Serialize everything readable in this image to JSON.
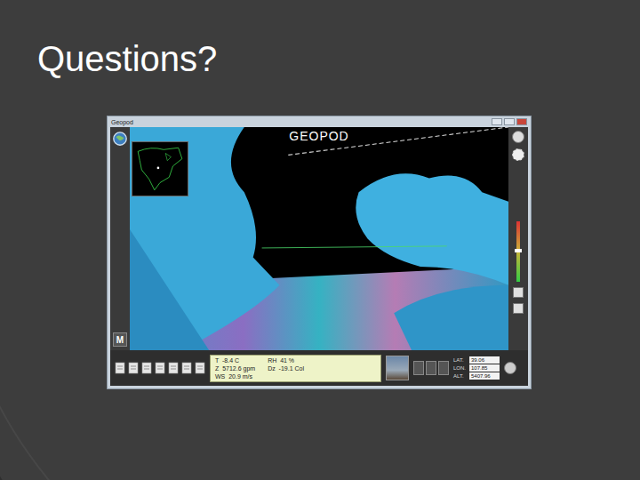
{
  "slide": {
    "title": "Questions?"
  },
  "window": {
    "title": "Geopod"
  },
  "app": {
    "logo": "GEOPOD",
    "mode_button": "M"
  },
  "readouts_left": [
    "T  -8.4 C",
    "Z  5712.6 gpm",
    "WS  20.9 m/s"
  ],
  "readouts_right": [
    "RH  41 %",
    "Dz  -19.1 Col"
  ],
  "position": [
    {
      "label": "LAT.",
      "value": "39.06"
    },
    {
      "label": "LON.",
      "value": "107.85"
    },
    {
      "label": "ALT.",
      "value": "5407.96"
    }
  ],
  "altitude_slider": {
    "level": 0.52
  }
}
